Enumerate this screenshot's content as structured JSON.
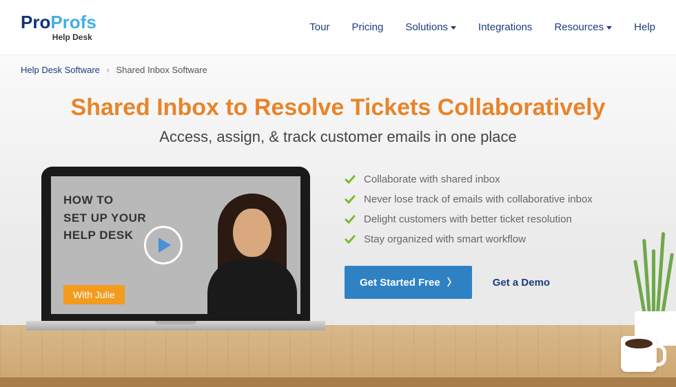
{
  "logo": {
    "pro": "Pro",
    "profs": "Profs",
    "sub": "Help Desk"
  },
  "nav": {
    "tour": "Tour",
    "pricing": "Pricing",
    "solutions": "Solutions",
    "integrations": "Integrations",
    "resources": "Resources",
    "help": "Help"
  },
  "breadcrumb": {
    "root": "Help Desk Software",
    "sep": "›",
    "current": "Shared Inbox Software"
  },
  "hero": {
    "title": "Shared Inbox to Resolve Tickets Collaboratively",
    "subtitle": "Access, assign, & track customer emails in one place"
  },
  "video": {
    "line1": "HOW TO",
    "line2": "SET UP YOUR",
    "line3": "HELP DESK",
    "badge": "With Julie"
  },
  "features": [
    "Collaborate with shared inbox",
    "Never lose track of emails with collaborative inbox",
    "Delight customers with better ticket resolution",
    "Stay organized with smart workflow"
  ],
  "cta": {
    "primary": "Get Started Free",
    "secondary": "Get a Demo"
  }
}
